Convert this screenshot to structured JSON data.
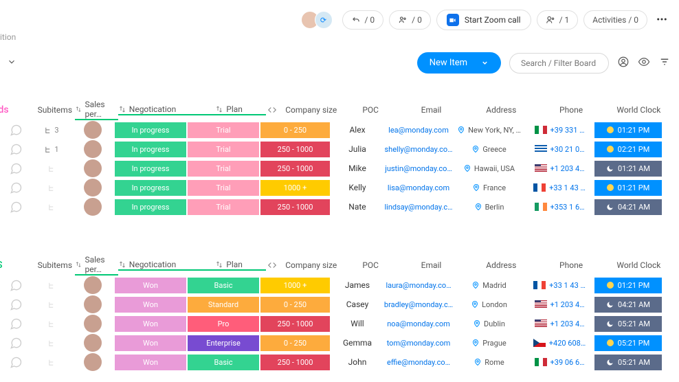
{
  "topbar": {
    "reply": "/ 0",
    "team": "/ 0",
    "zoom": "Start Zoom call",
    "people": "/ 1",
    "activities": "Activities / 0"
  },
  "breadcrumb_tail": "ition",
  "secondary": {
    "new_item": "New Item",
    "search_placeholder": "Search / Filter Board"
  },
  "groups": [
    {
      "title": "ads",
      "title_class": "leads",
      "columns": {
        "subitems": "Subitems",
        "sales": "Sales per…",
        "neg": "Negotication",
        "plan": "Plan",
        "size": "Company size",
        "poc": "POC",
        "email": "Email",
        "addr": "Address",
        "phone": "Phone",
        "clock": "World Clock"
      },
      "rows": [
        {
          "sub": "3",
          "neg": {
            "t": "In progress",
            "c": "#33d391"
          },
          "plan": {
            "t": "Trial",
            "c": "#ff9eb8"
          },
          "size": {
            "t": "0 - 250",
            "c": "#fdab3d"
          },
          "poc": "Alex",
          "email": "lea@monday.com",
          "addr": "New York, NY, …",
          "flag": "flag-it",
          "phone": "+39 331 …",
          "clock": {
            "t": "01:21 PM",
            "k": "day"
          }
        },
        {
          "sub": "1",
          "neg": {
            "t": "In progress",
            "c": "#33d391"
          },
          "plan": {
            "t": "Trial",
            "c": "#ff9eb8"
          },
          "size": {
            "t": "250 - 1000",
            "c": "#e2445c"
          },
          "poc": "Julia",
          "email": "shelly@monday.co…",
          "addr": "Greece",
          "flag": "flag-gr",
          "phone": "+30 21 0…",
          "clock": {
            "t": "02:21 PM",
            "k": "day"
          }
        },
        {
          "sub": "",
          "neg": {
            "t": "In progress",
            "c": "#33d391"
          },
          "plan": {
            "t": "Trial",
            "c": "#ff9eb8"
          },
          "size": {
            "t": "250 - 1000",
            "c": "#e2445c"
          },
          "poc": "Mike",
          "email": "justin@monday.co…",
          "addr": "Hawaii, USA",
          "flag": "flag-us",
          "phone": "+1 203 4…",
          "clock": {
            "t": "01:21 AM",
            "k": "night"
          }
        },
        {
          "sub": "",
          "neg": {
            "t": "In progress",
            "c": "#33d391"
          },
          "plan": {
            "t": "Trial",
            "c": "#ff9eb8"
          },
          "size": {
            "t": "1000 +",
            "c": "#ffcb00"
          },
          "poc": "Kelly",
          "email": "lisa@monday.com",
          "addr": "France",
          "flag": "flag-fr",
          "phone": "+33 1 43 …",
          "clock": {
            "t": "01:21 PM",
            "k": "day"
          }
        },
        {
          "sub": "",
          "neg": {
            "t": "In progress",
            "c": "#33d391"
          },
          "plan": {
            "t": "Trial",
            "c": "#ff9eb8"
          },
          "size": {
            "t": "250 - 1000",
            "c": "#e2445c"
          },
          "poc": "Nate",
          "email": "lindsay@monday.c…",
          "addr": "Berlin",
          "flag": "flag-ie",
          "phone": "+353 1 6…",
          "clock": {
            "t": "04:21 AM",
            "k": "night"
          }
        }
      ]
    },
    {
      "title": "S",
      "title_class": "deals",
      "columns": {
        "subitems": "Subitems",
        "sales": "Sales per…",
        "neg": "Negotication",
        "plan": "Plan",
        "size": "Company size",
        "poc": "POC",
        "email": "Email",
        "addr": "Address",
        "phone": "Phone",
        "clock": "World Clock"
      },
      "rows": [
        {
          "sub": "",
          "neg": {
            "t": "Won",
            "c": "#e99bd8"
          },
          "plan": {
            "t": "Basic",
            "c": "#33d391"
          },
          "size": {
            "t": "1000 +",
            "c": "#ffcb00"
          },
          "poc": "James",
          "email": "laura@monday.co…",
          "addr": "Madrid",
          "flag": "flag-fr",
          "phone": "+33 1 43 …",
          "clock": {
            "t": "01:21 PM",
            "k": "day"
          }
        },
        {
          "sub": "",
          "neg": {
            "t": "Won",
            "c": "#e99bd8"
          },
          "plan": {
            "t": "Standard",
            "c": "#fdab3d"
          },
          "size": {
            "t": "0 - 250",
            "c": "#fdab3d"
          },
          "poc": "Casey",
          "email": "bradley@monday.c…",
          "addr": "London",
          "flag": "flag-us",
          "phone": "+1 203 4…",
          "clock": {
            "t": "04:21 AM",
            "k": "night"
          }
        },
        {
          "sub": "",
          "neg": {
            "t": "Won",
            "c": "#e99bd8"
          },
          "plan": {
            "t": "Pro",
            "c": "#ff5d7a"
          },
          "size": {
            "t": "250 - 1000",
            "c": "#e2445c"
          },
          "poc": "Will",
          "email": "noa@monday.com",
          "addr": "Dublin",
          "flag": "flag-us",
          "phone": "+1 203 4…",
          "clock": {
            "t": "05:21 AM",
            "k": "night"
          }
        },
        {
          "sub": "",
          "neg": {
            "t": "Won",
            "c": "#e99bd8"
          },
          "plan": {
            "t": "Enterprise",
            "c": "#784bd1"
          },
          "size": {
            "t": "0 - 250",
            "c": "#fdab3d"
          },
          "poc": "Gemma",
          "email": "tom@monday.com",
          "addr": "Prague",
          "flag": "flag-cz",
          "phone": "+420 608…",
          "clock": {
            "t": "05:21 PM",
            "k": "day"
          }
        },
        {
          "sub": "",
          "neg": {
            "t": "Won",
            "c": "#e99bd8"
          },
          "plan": {
            "t": "Basic",
            "c": "#33d391"
          },
          "size": {
            "t": "250 - 1000",
            "c": "#e2445c"
          },
          "poc": "John",
          "email": "effie@monday.co…",
          "addr": "Rome",
          "flag": "flag-it",
          "phone": "+39 06 6…",
          "clock": {
            "t": "05:21 AM",
            "k": "night"
          }
        }
      ]
    }
  ]
}
